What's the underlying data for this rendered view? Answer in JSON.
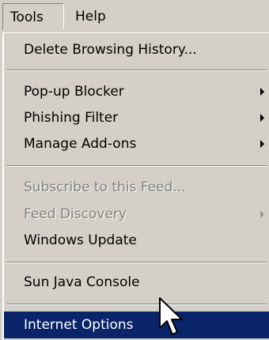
{
  "menubar": {
    "tools_label": "Tools",
    "help_label": "Help"
  },
  "menu": {
    "delete_history": "Delete Browsing History...",
    "popup_blocker": "Pop-up Blocker",
    "phishing_filter": "Phishing Filter",
    "manage_addons": "Manage Add-ons",
    "subscribe_feed": "Subscribe to this Feed...",
    "feed_discovery": "Feed Discovery",
    "windows_update": "Windows Update",
    "sun_java": "Sun Java Console",
    "internet_options": "Internet Options"
  },
  "colors": {
    "menu_bg": "#d4d0c8",
    "highlight": "#0a246a",
    "disabled_text": "#808080"
  }
}
